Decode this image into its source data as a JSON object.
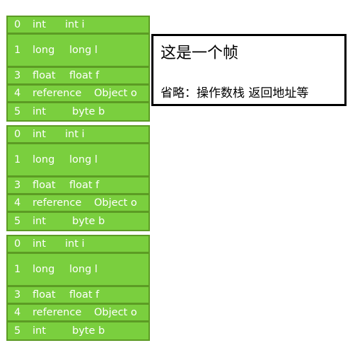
{
  "frames": [
    {
      "slots": [
        {
          "index": "0",
          "type": "int",
          "decl": "int i"
        },
        {
          "index": "1",
          "type": "long",
          "decl": "long l"
        },
        {
          "index": "3",
          "type": "float",
          "decl": "float f"
        },
        {
          "index": "4",
          "type": "reference",
          "decl": "Object o"
        },
        {
          "index": "5",
          "type": "int",
          "decl": "byte b"
        }
      ]
    },
    {
      "slots": [
        {
          "index": "0",
          "type": "int",
          "decl": "int i"
        },
        {
          "index": "1",
          "type": "long",
          "decl": "long l"
        },
        {
          "index": "3",
          "type": "float",
          "decl": "float f"
        },
        {
          "index": "4",
          "type": "reference",
          "decl": "Object o"
        },
        {
          "index": "5",
          "type": "int",
          "decl": "byte b"
        }
      ]
    },
    {
      "slots": [
        {
          "index": "0",
          "type": "int",
          "decl": "int i"
        },
        {
          "index": "1",
          "type": "long",
          "decl": "long l"
        },
        {
          "index": "3",
          "type": "float",
          "decl": "float f"
        },
        {
          "index": "4",
          "type": "reference",
          "decl": "Object o"
        },
        {
          "index": "5",
          "type": "int",
          "decl": "byte b"
        }
      ]
    }
  ],
  "note": {
    "title": "这是一个帧",
    "subtitle": "省略：操作数栈 返回地址等"
  },
  "colors": {
    "slot_fill": "#7acf3e",
    "slot_border": "#5c9b24",
    "text": "#ffffff"
  }
}
